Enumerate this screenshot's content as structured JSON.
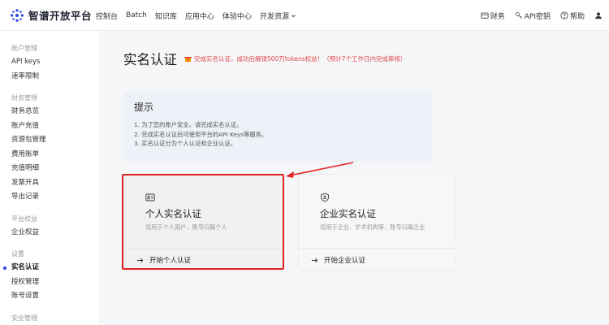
{
  "app": {
    "name": "智谱开放平台"
  },
  "nav": {
    "items": [
      "控制台",
      "Batch",
      "知识库",
      "应用中心",
      "体验中心",
      "开发资源"
    ]
  },
  "tools": {
    "finance": "财务",
    "api_key": "API密钥",
    "help": "帮助"
  },
  "sidebar": {
    "groups": [
      {
        "title": "账户管理",
        "items": [
          "API keys",
          "速率限制"
        ]
      },
      {
        "title": "财务管理",
        "items": [
          "财务总览",
          "账户充值",
          "资源包管理",
          "费用账单",
          "充值明细",
          "发票开具",
          "导出记录"
        ]
      },
      {
        "title": "平台权益",
        "items": [
          "企业权益"
        ]
      },
      {
        "title": "设置",
        "items": [
          "实名认证",
          "授权管理",
          "账号设置"
        ]
      },
      {
        "title": "安全管理",
        "items": []
      }
    ],
    "active": "实名认证"
  },
  "page": {
    "title": "实名认证",
    "promo": "完成实名认证，成功后解锁500万tokens权益！（预计7个工作日内完成审核）"
  },
  "tips": {
    "title": "提示",
    "lines": [
      "1. 为了您的账户安全，请完成实名认证。",
      "2. 完成实名认证后可使用平台的API Keys等服务。",
      "3. 实名认证分为个人认证和企业认证。"
    ]
  },
  "cards": {
    "personal": {
      "title": "个人实名认证",
      "desc": "适用于个人用户，账号归属个人",
      "action": "开始个人认证"
    },
    "company": {
      "title": "企业实名认证",
      "desc": "适用于企业、学术机构等，账号归属企业",
      "action": "开始企业认证"
    }
  },
  "colors": {
    "accent": "#2b47e8",
    "highlight": "#e02424",
    "promo": "#e0484b"
  }
}
